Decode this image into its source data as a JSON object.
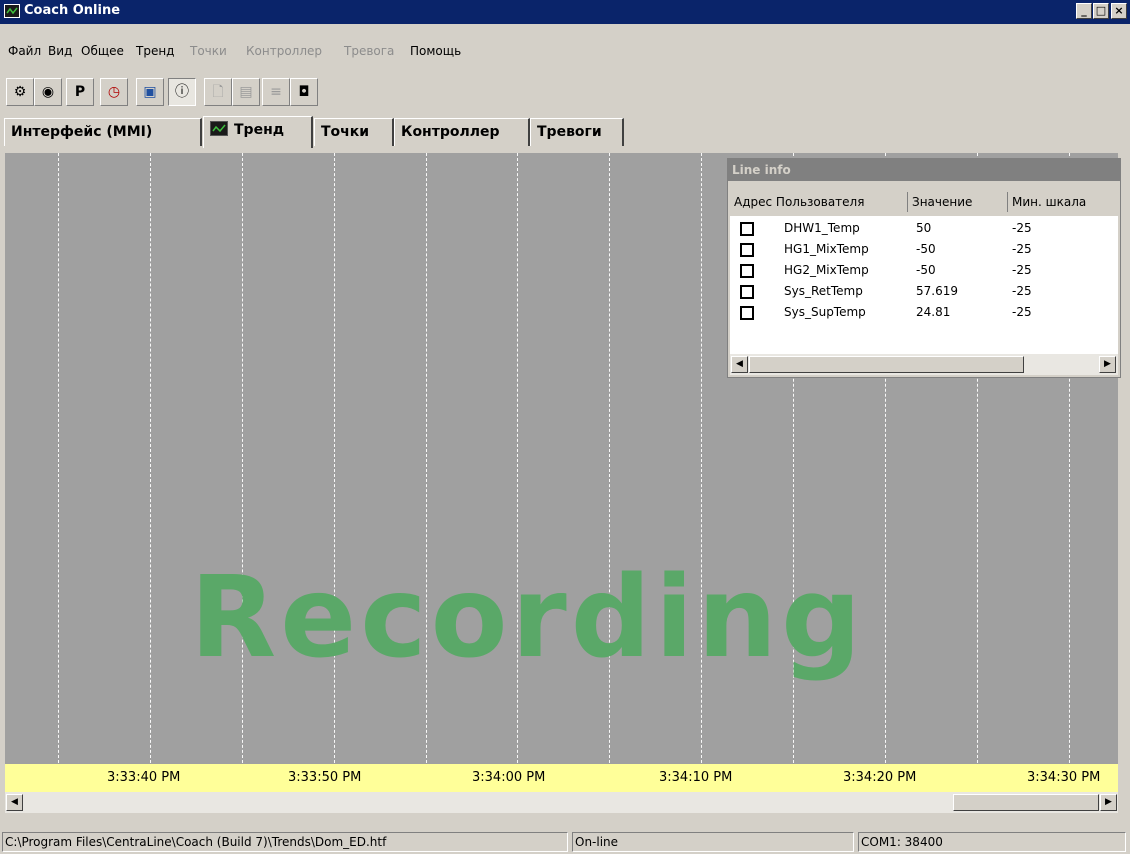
{
  "window": {
    "title": "Coach Online"
  },
  "menu": [
    "Файл",
    "Вид",
    "Общее",
    "Тренд",
    "Точки",
    "Контроллер",
    "Тревога",
    "Помощь"
  ],
  "toolbar": {
    "p_label": "P"
  },
  "tabs": [
    "Интерфейс (MMI)",
    "Тренд",
    "Точки",
    "Контроллер",
    "Тревоги"
  ],
  "chart": {
    "watermark": "Recording"
  },
  "line_info": {
    "title": "Line info",
    "columns": [
      "Адрес Пользователя",
      "Значение",
      "Мин. шкала"
    ],
    "rows": [
      {
        "name": "DHW1_Temp",
        "value": "50",
        "min": "-25"
      },
      {
        "name": "HG1_MixTemp",
        "value": "-50",
        "min": "-25"
      },
      {
        "name": "HG2_MixTemp",
        "value": "-50",
        "min": "-25"
      },
      {
        "name": "Sys_RetTemp",
        "value": "57.619",
        "min": "-25"
      },
      {
        "name": "Sys_SupTemp",
        "value": "24.81",
        "min": "-25"
      }
    ]
  },
  "time_axis": [
    "3:33:40 PM",
    "3:33:50 PM",
    "3:34:00 PM",
    "3:34:10 PM",
    "3:34:20 PM",
    "3:34:30 PM"
  ],
  "status": {
    "path": "C:\\Program Files\\CentraLine\\Coach (Build 7)\\Trends\\Dom_ED.htf",
    "state": "On-line",
    "port": "COM1: 38400"
  }
}
